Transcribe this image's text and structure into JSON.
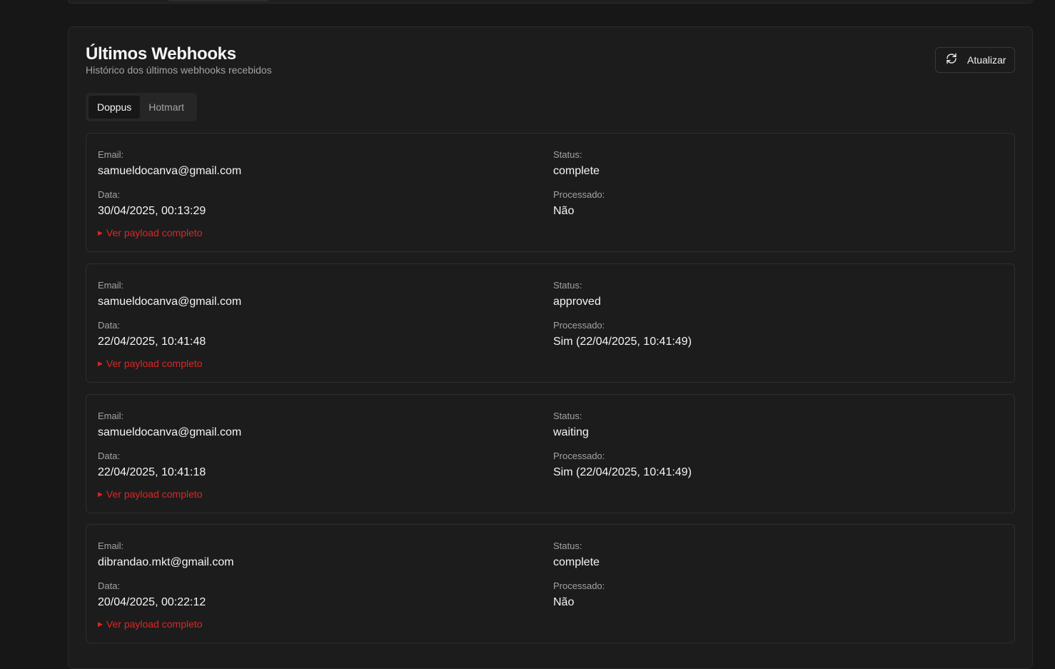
{
  "header": {
    "title": "Últimos Webhooks",
    "subtitle": "Histórico dos últimos webhooks recebidos",
    "refresh_label": "Atualizar"
  },
  "tabs": [
    {
      "label": "Doppus",
      "active": true
    },
    {
      "label": "Hotmart",
      "active": false
    }
  ],
  "field_labels": {
    "email": "Email:",
    "status": "Status:",
    "date": "Data:",
    "processed": "Processado:"
  },
  "payload_link": "Ver payload completo",
  "webhooks": [
    {
      "email": "samueldocanva@gmail.com",
      "status": "complete",
      "date": "30/04/2025, 00:13:29",
      "processed": "Não"
    },
    {
      "email": "samueldocanva@gmail.com",
      "status": "approved",
      "date": "22/04/2025, 10:41:48",
      "processed": "Sim (22/04/2025, 10:41:49)"
    },
    {
      "email": "samueldocanva@gmail.com",
      "status": "waiting",
      "date": "22/04/2025, 10:41:18",
      "processed": "Sim (22/04/2025, 10:41:49)"
    },
    {
      "email": "dibrandao.mkt@gmail.com",
      "status": "complete",
      "date": "20/04/2025, 00:22:12",
      "processed": "Não"
    }
  ],
  "colors": {
    "background": "#171717",
    "panel": "#1c1c1c",
    "accent_link": "#dc2626"
  }
}
